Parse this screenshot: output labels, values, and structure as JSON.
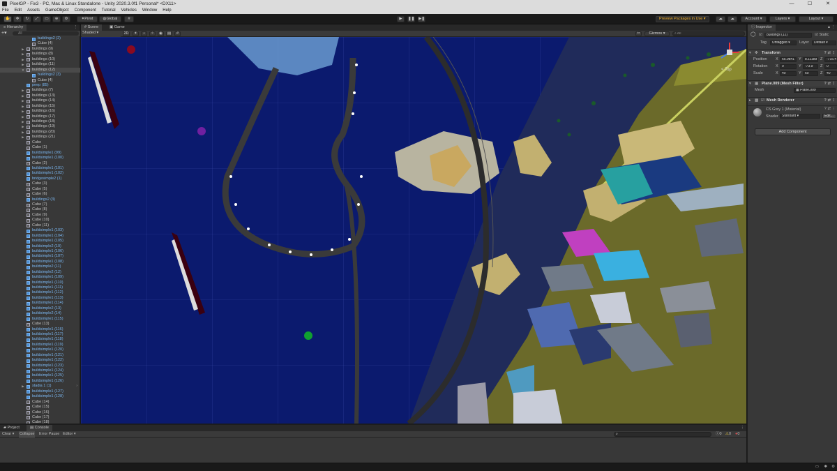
{
  "window": {
    "title": "PixelGP - Fix3 - PC, Mac & Linux Standalone - Unity 2020.3.0f1 Personal* <DX11>",
    "controls": [
      "—",
      "☐",
      "✕"
    ]
  },
  "menu": [
    "File",
    "Edit",
    "Assets",
    "GameObject",
    "Component",
    "Tutorial",
    "Vehicles",
    "Window",
    "Help"
  ],
  "toolbar": {
    "pivot_label": "Pivot",
    "global_label": "Global",
    "preview_packages_label": "Preview Packages in Use",
    "account_label": "Account",
    "layers_label": "Layers",
    "layout_label": "Layout"
  },
  "hierarchy": {
    "tab_label": "Hierarchy",
    "search_placeholder": "All",
    "rows": [
      {
        "label": "buildings2 (2)",
        "prefab": true,
        "indent": 1,
        "arrow": false
      },
      {
        "label": "Cube (4)",
        "prefab": false,
        "indent": 1,
        "arrow": false
      },
      {
        "label": "buildings (9)",
        "prefab": false,
        "indent": 0,
        "arrow": true
      },
      {
        "label": "buildings (8)",
        "prefab": false,
        "indent": 0,
        "arrow": true
      },
      {
        "label": "buildings (10)",
        "prefab": false,
        "indent": 0,
        "arrow": true
      },
      {
        "label": "buildings (11)",
        "prefab": false,
        "indent": 0,
        "arrow": true
      },
      {
        "label": "buildings (12)",
        "prefab": false,
        "indent": 0,
        "arrow": true,
        "open": true,
        "selected": true
      },
      {
        "label": "buildings2 (3)",
        "prefab": true,
        "indent": 1,
        "arrow": false
      },
      {
        "label": "Cube (4)",
        "prefab": false,
        "indent": 1,
        "arrow": false
      },
      {
        "label": "peep (85)",
        "prefab": true,
        "indent": 0,
        "arrow": false
      },
      {
        "label": "buildings (7)",
        "prefab": false,
        "indent": 0,
        "arrow": true
      },
      {
        "label": "buildings (13)",
        "prefab": false,
        "indent": 0,
        "arrow": true
      },
      {
        "label": "buildings (14)",
        "prefab": false,
        "indent": 0,
        "arrow": true
      },
      {
        "label": "buildings (15)",
        "prefab": false,
        "indent": 0,
        "arrow": true
      },
      {
        "label": "buildings (16)",
        "prefab": false,
        "indent": 0,
        "arrow": true
      },
      {
        "label": "buildings (17)",
        "prefab": false,
        "indent": 0,
        "arrow": true
      },
      {
        "label": "buildings (18)",
        "prefab": false,
        "indent": 0,
        "arrow": true
      },
      {
        "label": "buildings (19)",
        "prefab": false,
        "indent": 0,
        "arrow": true
      },
      {
        "label": "buildings (20)",
        "prefab": false,
        "indent": 0,
        "arrow": true
      },
      {
        "label": "buildings (21)",
        "prefab": false,
        "indent": 0,
        "arrow": true
      },
      {
        "label": "Cube",
        "prefab": false,
        "indent": 0,
        "arrow": false
      },
      {
        "label": "Cube (1)",
        "prefab": false,
        "indent": 0,
        "arrow": false
      },
      {
        "label": "buildsimple1 (99)",
        "prefab": true,
        "indent": 0,
        "arrow": false
      },
      {
        "label": "buildsimple1 (100)",
        "prefab": true,
        "indent": 0,
        "arrow": false
      },
      {
        "label": "Cube (2)",
        "prefab": false,
        "indent": 0,
        "arrow": false
      },
      {
        "label": "buildsimple1 (101)",
        "prefab": true,
        "indent": 0,
        "arrow": false
      },
      {
        "label": "buildsimple1 (102)",
        "prefab": true,
        "indent": 0,
        "arrow": false
      },
      {
        "label": "bridgesimple2 (1)",
        "prefab": true,
        "indent": 0,
        "arrow": false
      },
      {
        "label": "Cube (3)",
        "prefab": false,
        "indent": 0,
        "arrow": false
      },
      {
        "label": "Cube (5)",
        "prefab": false,
        "indent": 0,
        "arrow": false
      },
      {
        "label": "Cube (6)",
        "prefab": false,
        "indent": 0,
        "arrow": false
      },
      {
        "label": "buildings2 (3)",
        "prefab": true,
        "indent": 0,
        "arrow": false
      },
      {
        "label": "Cube (7)",
        "prefab": false,
        "indent": 0,
        "arrow": false
      },
      {
        "label": "Cube (8)",
        "prefab": false,
        "indent": 0,
        "arrow": false
      },
      {
        "label": "Cube (9)",
        "prefab": false,
        "indent": 0,
        "arrow": false
      },
      {
        "label": "Cube (10)",
        "prefab": false,
        "indent": 0,
        "arrow": false
      },
      {
        "label": "Cube (11)",
        "prefab": false,
        "indent": 0,
        "arrow": false
      },
      {
        "label": "buildsimple1 (103)",
        "prefab": true,
        "indent": 0,
        "arrow": false
      },
      {
        "label": "buildsimple1 (104)",
        "prefab": true,
        "indent": 0,
        "arrow": false
      },
      {
        "label": "buildsimple1 (105)",
        "prefab": true,
        "indent": 0,
        "arrow": false
      },
      {
        "label": "buildsimple2 (10)",
        "prefab": true,
        "indent": 0,
        "arrow": false
      },
      {
        "label": "buildsimple1 (106)",
        "prefab": true,
        "indent": 0,
        "arrow": false
      },
      {
        "label": "buildsimple1 (107)",
        "prefab": true,
        "indent": 0,
        "arrow": false
      },
      {
        "label": "buildsimple1 (108)",
        "prefab": true,
        "indent": 0,
        "arrow": false
      },
      {
        "label": "buildsimple2 (11)",
        "prefab": true,
        "indent": 0,
        "arrow": false
      },
      {
        "label": "buildsimple2 (12)",
        "prefab": true,
        "indent": 0,
        "arrow": false
      },
      {
        "label": "buildsimple1 (109)",
        "prefab": true,
        "indent": 0,
        "arrow": false
      },
      {
        "label": "buildsimple1 (110)",
        "prefab": true,
        "indent": 0,
        "arrow": false
      },
      {
        "label": "buildsimple1 (111)",
        "prefab": true,
        "indent": 0,
        "arrow": false
      },
      {
        "label": "buildsimple1 (112)",
        "prefab": true,
        "indent": 0,
        "arrow": false
      },
      {
        "label": "buildsimple1 (113)",
        "prefab": true,
        "indent": 0,
        "arrow": false
      },
      {
        "label": "buildsimple1 (114)",
        "prefab": true,
        "indent": 0,
        "arrow": false
      },
      {
        "label": "buildsimple2 (13)",
        "prefab": true,
        "indent": 0,
        "arrow": false
      },
      {
        "label": "buildsimple2 (14)",
        "prefab": true,
        "indent": 0,
        "arrow": false
      },
      {
        "label": "buildsimple1 (115)",
        "prefab": true,
        "indent": 0,
        "arrow": false
      },
      {
        "label": "Cube (13)",
        "prefab": false,
        "indent": 0,
        "arrow": false
      },
      {
        "label": "buildsimple1 (116)",
        "prefab": true,
        "indent": 0,
        "arrow": false
      },
      {
        "label": "buildsimple1 (117)",
        "prefab": true,
        "indent": 0,
        "arrow": false
      },
      {
        "label": "buildsimple1 (118)",
        "prefab": true,
        "indent": 0,
        "arrow": false
      },
      {
        "label": "buildsimple1 (119)",
        "prefab": true,
        "indent": 0,
        "arrow": false
      },
      {
        "label": "buildsimple1 (120)",
        "prefab": true,
        "indent": 0,
        "arrow": false
      },
      {
        "label": "buildsimple1 (121)",
        "prefab": true,
        "indent": 0,
        "arrow": false
      },
      {
        "label": "buildsimple1 (122)",
        "prefab": true,
        "indent": 0,
        "arrow": false
      },
      {
        "label": "buildsimple1 (123)",
        "prefab": true,
        "indent": 0,
        "arrow": false
      },
      {
        "label": "buildsimple1 (124)",
        "prefab": true,
        "indent": 0,
        "arrow": false
      },
      {
        "label": "buildsimple1 (125)",
        "prefab": true,
        "indent": 0,
        "arrow": false
      },
      {
        "label": "buildsimple1 (126)",
        "prefab": true,
        "indent": 0,
        "arrow": false
      },
      {
        "label": "stadia 1 (1)",
        "prefab": true,
        "indent": 0,
        "arrow": true,
        "chevron": true
      },
      {
        "label": "buildsimple1 (127)",
        "prefab": true,
        "indent": 0,
        "arrow": false
      },
      {
        "label": "buildsimple1 (128)",
        "prefab": true,
        "indent": 0,
        "arrow": false
      },
      {
        "label": "Cube (14)",
        "prefab": false,
        "indent": 0,
        "arrow": false
      },
      {
        "label": "Cube (15)",
        "prefab": false,
        "indent": 0,
        "arrow": false
      },
      {
        "label": "Cube (16)",
        "prefab": false,
        "indent": 0,
        "arrow": false
      },
      {
        "label": "Cube (17)",
        "prefab": false,
        "indent": 0,
        "arrow": false
      },
      {
        "label": "Cube (18)",
        "prefab": false,
        "indent": 0,
        "arrow": false
      }
    ]
  },
  "scene": {
    "tabs": [
      "Scene",
      "Game"
    ],
    "shading_mode": "Shaded",
    "mode_2d": "2D",
    "gizmos_label": "Gizmos",
    "search_placeholder": "All",
    "gizmo_view_label": "< Top"
  },
  "inspector": {
    "tab_label": "Inspector",
    "object_name": "buildings (12)",
    "static_label": "Static",
    "tag_label": "Tag",
    "tag_value": "Untagged",
    "layer_label": "Layer",
    "layer_value": "Default",
    "transform": {
      "title": "Transform",
      "position_label": "Position",
      "rotation_label": "Rotation",
      "scale_label": "Scale",
      "position": {
        "x": "65.9841",
        "y": "8.11189",
        "z": "-715.45"
      },
      "rotation": {
        "x": "0",
        "y": "-73.9",
        "z": "0"
      },
      "scale": {
        "x": "40",
        "y": "60",
        "z": "40"
      }
    },
    "mesh_filter": {
      "title": "Plane.009 (Mesh Filter)",
      "mesh_label": "Mesh",
      "mesh_value": "Plane.009"
    },
    "mesh_renderer": {
      "title": "Mesh Renderer"
    },
    "material": {
      "name": "CS Grey 1 (Material)",
      "shader_label": "Shader",
      "shader_value": "Standard",
      "edit_label": "Edit..."
    },
    "add_component_label": "Add Component"
  },
  "console": {
    "tabs": [
      "Project",
      "Console"
    ],
    "clear_label": "Clear",
    "collapse_label": "Collapse",
    "error_pause_label": "Error Pause",
    "editor_label": "Editor",
    "counts": {
      "log": "0",
      "warn": "0",
      "error": "0"
    }
  }
}
